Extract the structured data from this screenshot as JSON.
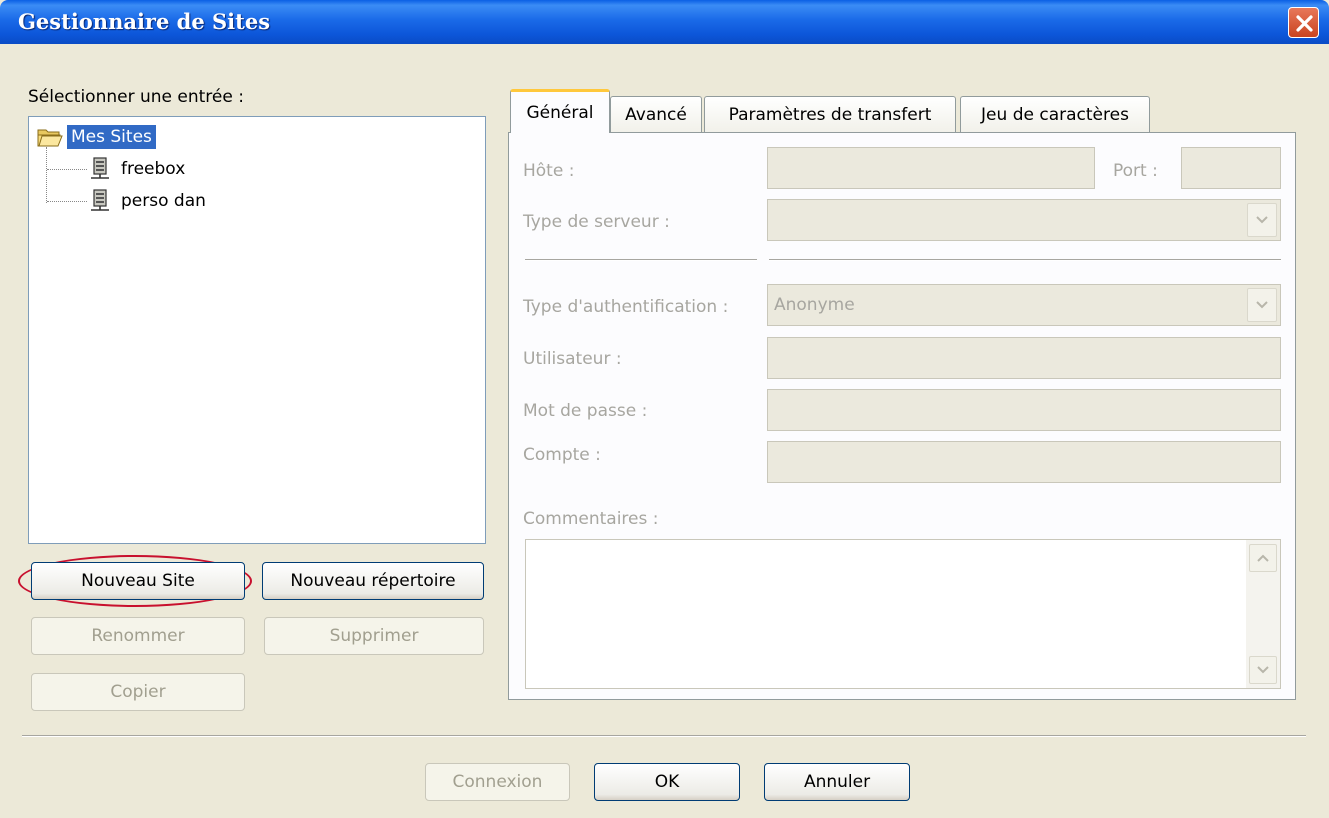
{
  "window": {
    "title": "Gestionnaire de Sites"
  },
  "left": {
    "select_label": "Sélectionner une entrée :",
    "tree": {
      "root": {
        "label": "Mes Sites",
        "icon": "folder-open-icon",
        "selected": true
      },
      "children": [
        {
          "label": "freebox",
          "icon": "server-icon"
        },
        {
          "label": "perso dan",
          "icon": "server-icon"
        }
      ]
    },
    "buttons": {
      "new_site": "Nouveau Site",
      "new_folder": "Nouveau répertoire",
      "rename": "Renommer",
      "delete": "Supprimer",
      "copy": "Copier"
    }
  },
  "tabs": [
    "Général",
    "Avancé",
    "Paramètres de transfert",
    "Jeu de caractères"
  ],
  "active_tab": "Général",
  "general": {
    "host_label": "Hôte :",
    "port_label": "Port :",
    "server_type_label": "Type de serveur :",
    "auth_type_label": "Type d'authentification :",
    "auth_type_value": "Anonyme",
    "user_label": "Utilisateur :",
    "password_label": "Mot de passe :",
    "account_label": "Compte :",
    "comments_label": "Commentaires :"
  },
  "footer": {
    "connect": "Connexion",
    "ok": "OK",
    "cancel": "Annuler"
  },
  "colors": {
    "titlebar": "#0c55d8",
    "selection": "#316ac5",
    "highlight_ellipse": "#c8102e",
    "tab_active_accent": "#ffc83c"
  }
}
